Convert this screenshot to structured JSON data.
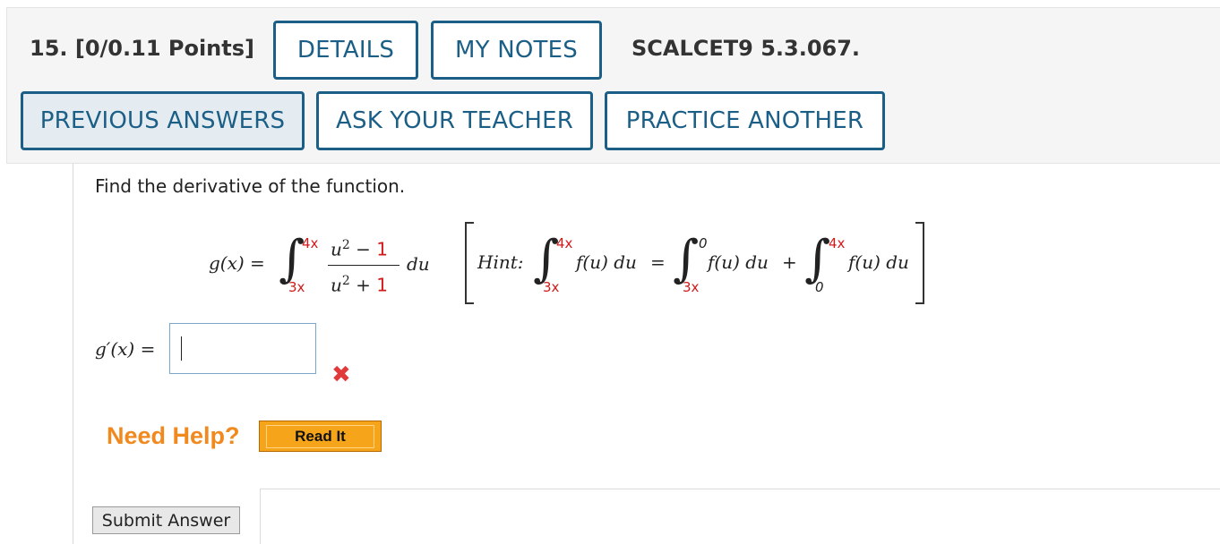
{
  "header": {
    "question_label": "15.  [0/0.11 Points]",
    "details_label": "DETAILS",
    "my_notes_label": "MY NOTES",
    "code": "SCALCET9 5.3.067.",
    "previous_answers_label": "PREVIOUS ANSWERS",
    "ask_teacher_label": "ASK YOUR TEACHER",
    "practice_another_label": "PRACTICE ANOTHER"
  },
  "problem": {
    "prompt": "Find the derivative of the function.",
    "function_lhs": "g(x) =",
    "upper_limit": "4x",
    "lower_limit": "3x",
    "numerator_var": "u",
    "numerator_exp": "2",
    "numerator_op": "−",
    "numerator_const": "1",
    "denominator_var": "u",
    "denominator_exp": "2",
    "denominator_op": "+",
    "denominator_const": "1",
    "differential": "du",
    "hint_label": "Hint:",
    "hint_integrand": "f(u) du",
    "hint_eq": "=",
    "hint_plus": "+",
    "hint_int1_upper": "4x",
    "hint_int1_lower": "3x",
    "hint_int2_upper": "0",
    "hint_int2_lower": "3x",
    "hint_int3_upper": "4x",
    "hint_int3_lower": "0"
  },
  "answer": {
    "label": "g′(x) =",
    "value": "",
    "status_icon": "incorrect-x-icon",
    "status_color": "#e03a3a"
  },
  "help": {
    "need_help_label": "Need Help?",
    "read_it_label": "Read It",
    "need_help_color": "#f0891e"
  },
  "submit": {
    "label": "Submit Answer"
  },
  "colors": {
    "accent": "#1c5f86",
    "highlight_red": "#d11a1a"
  }
}
